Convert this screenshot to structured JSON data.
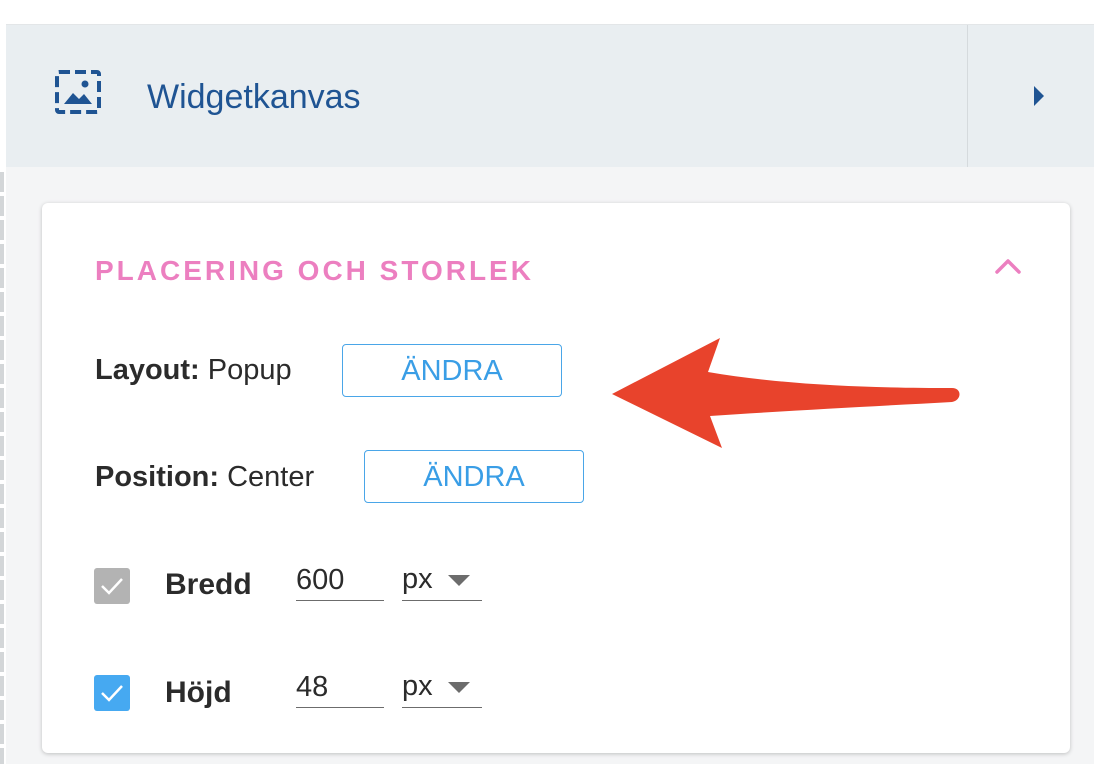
{
  "header": {
    "title": "Widgetkanvas",
    "icon": "image-frame-icon",
    "expand_icon": "caret-right-icon",
    "colors": {
      "background": "#e9eef1",
      "title": "#1f5493"
    }
  },
  "section": {
    "title": "PLACERING OCH STORLEK",
    "collapse_icon": "chevron-up-icon",
    "title_color": "#ec7fc0"
  },
  "layout_row": {
    "key": "Layout:",
    "value": "Popup",
    "button_label": "ÄNDRA"
  },
  "position_row": {
    "key": "Position:",
    "value": "Center",
    "button_label": "ÄNDRA"
  },
  "width_row": {
    "checked": true,
    "disabled": true,
    "label": "Bredd",
    "value": "600",
    "unit": "px"
  },
  "height_row": {
    "checked": true,
    "disabled": false,
    "label": "Höjd",
    "value": "48",
    "unit": "px"
  },
  "annotation": {
    "type": "arrow",
    "color": "#e8432c",
    "points_to": "layout-change-button"
  },
  "accent_colors": {
    "button": "#3a9ee6",
    "checkbox_checked": "#46a9f1",
    "checkbox_disabled": "#b3b3b3"
  }
}
